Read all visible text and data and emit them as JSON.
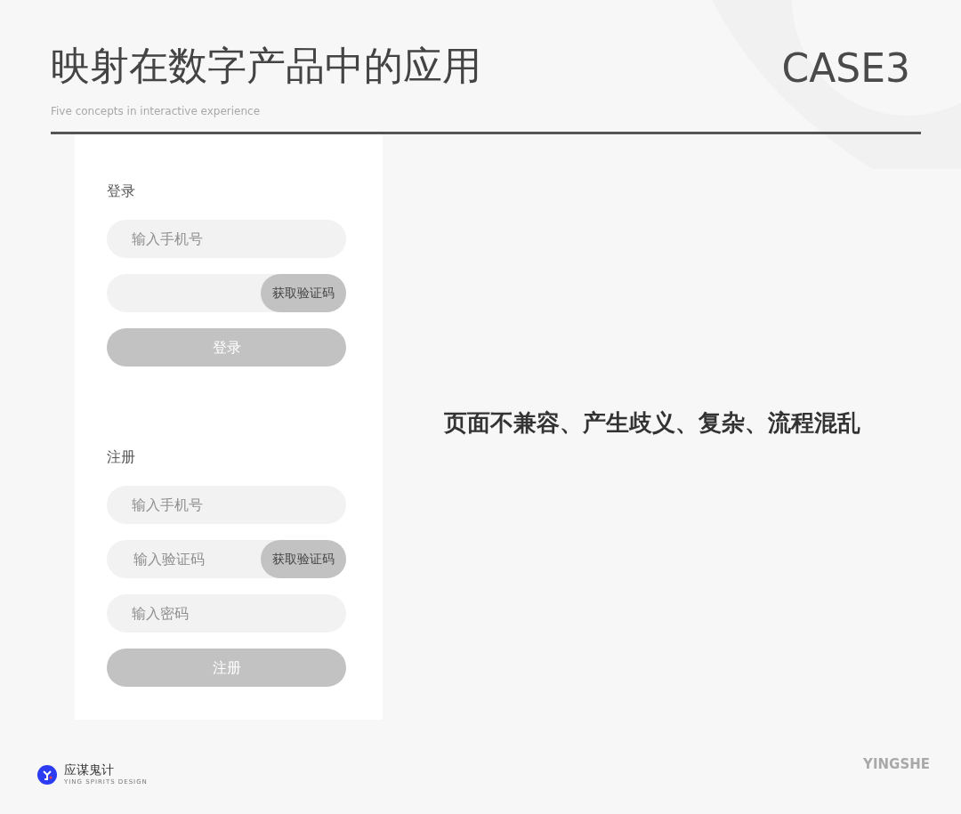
{
  "header": {
    "title": "映射在数字产品中的应用",
    "case_label": "CASE3",
    "subtitle": "Five concepts in interactive experience"
  },
  "form_sections": [
    {
      "heading": "登录",
      "fields": [
        {
          "kind": "input",
          "placeholder": "输入手机号"
        },
        {
          "kind": "code",
          "button": "获取验证码"
        },
        {
          "kind": "submit",
          "label": "登录"
        }
      ]
    },
    {
      "heading": "注册",
      "fields": [
        {
          "kind": "input",
          "placeholder": "输入手机号"
        },
        {
          "kind": "code",
          "placeholder": "输入验证码",
          "button": "获取验证码"
        },
        {
          "kind": "input",
          "placeholder": "输入密码"
        },
        {
          "kind": "submit",
          "label": "注册"
        }
      ]
    }
  ],
  "caption": "页面不兼容、产生歧义、复杂、流程混乱",
  "footer": {
    "brand": "应谋鬼计",
    "brand_tagline": "YING SPIRITS DESIGN",
    "watermark": "YINGSHE"
  }
}
